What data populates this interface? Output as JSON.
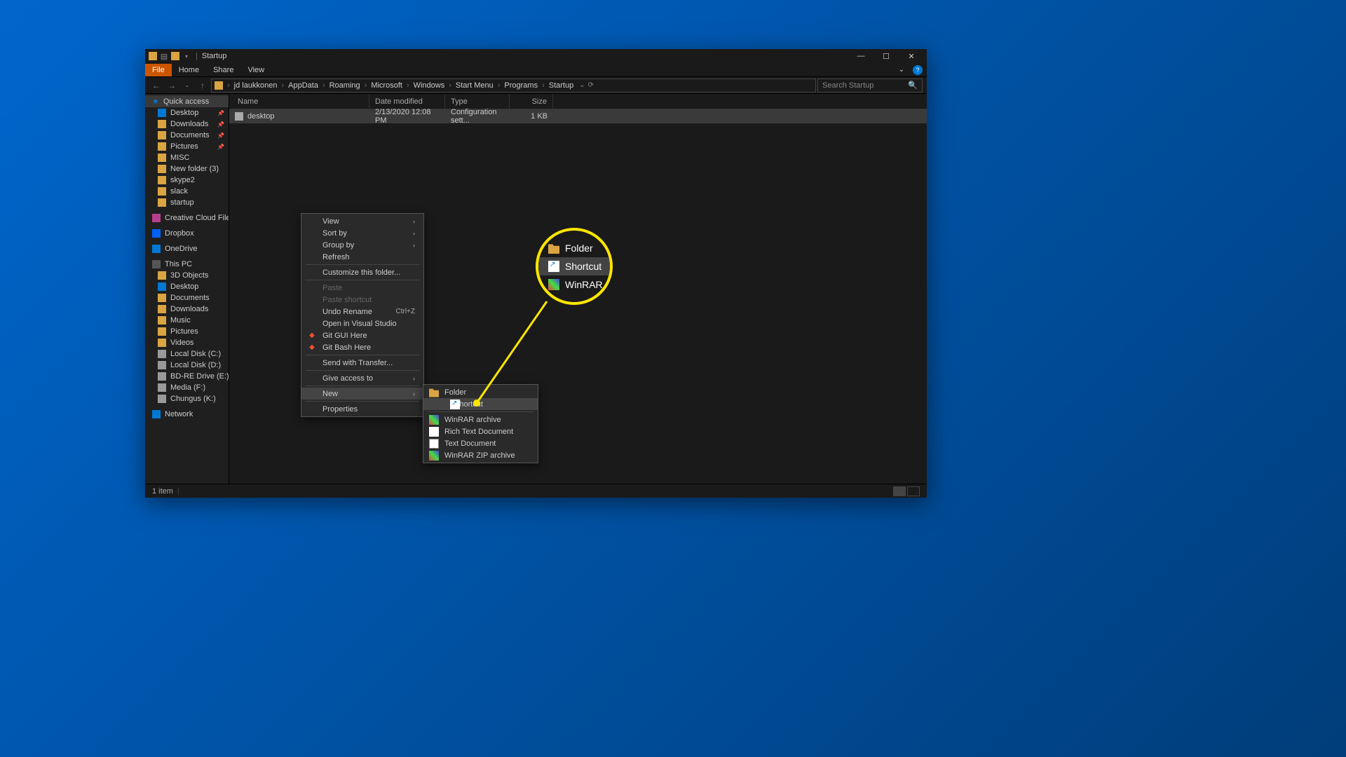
{
  "window": {
    "title": "Startup"
  },
  "titlebar_icons": [
    "folder-icon",
    "save-icon",
    "folder-open-icon"
  ],
  "ribbon": {
    "tabs": [
      "File",
      "Home",
      "Share",
      "View"
    ]
  },
  "breadcrumbs": [
    "jd laukkonen",
    "AppData",
    "Roaming",
    "Microsoft",
    "Windows",
    "Start Menu",
    "Programs",
    "Startup"
  ],
  "search": {
    "placeholder": "Search Startup"
  },
  "sidebar": {
    "quick_access": {
      "label": "Quick access"
    },
    "quick_items": [
      {
        "label": "Desktop",
        "icon": "icon-desktop",
        "pinned": true
      },
      {
        "label": "Downloads",
        "icon": "icon-folder",
        "pinned": true
      },
      {
        "label": "Documents",
        "icon": "icon-folder",
        "pinned": true
      },
      {
        "label": "Pictures",
        "icon": "icon-folder",
        "pinned": true
      },
      {
        "label": "MISC",
        "icon": "icon-folder",
        "pinned": false
      },
      {
        "label": "New folder (3)",
        "icon": "icon-folder",
        "pinned": false
      },
      {
        "label": "skype2",
        "icon": "icon-folder",
        "pinned": false
      },
      {
        "label": "slack",
        "icon": "icon-folder",
        "pinned": false
      },
      {
        "label": "startup",
        "icon": "icon-folder",
        "pinned": false
      }
    ],
    "creative_cloud": "Creative Cloud Files",
    "dropbox": "Dropbox",
    "onedrive": "OneDrive",
    "this_pc": {
      "label": "This PC"
    },
    "pc_items": [
      {
        "label": "3D Objects",
        "icon": "icon-folder"
      },
      {
        "label": "Desktop",
        "icon": "icon-desktop"
      },
      {
        "label": "Documents",
        "icon": "icon-folder"
      },
      {
        "label": "Downloads",
        "icon": "icon-folder"
      },
      {
        "label": "Music",
        "icon": "icon-folder"
      },
      {
        "label": "Pictures",
        "icon": "icon-folder"
      },
      {
        "label": "Videos",
        "icon": "icon-folder"
      },
      {
        "label": "Local Disk (C:)",
        "icon": "icon-drive"
      },
      {
        "label": "Local Disk (D:)",
        "icon": "icon-drive"
      },
      {
        "label": "BD-RE Drive (E:) GG",
        "icon": "icon-drive"
      },
      {
        "label": "Media (F:)",
        "icon": "icon-drive"
      },
      {
        "label": "Chungus (K:)",
        "icon": "icon-drive"
      }
    ],
    "network": "Network"
  },
  "columns": {
    "name": "Name",
    "date": "Date modified",
    "type": "Type",
    "size": "Size"
  },
  "files": [
    {
      "name": "desktop",
      "date": "2/13/2020 12:08 PM",
      "type": "Configuration sett...",
      "size": "1 KB"
    }
  ],
  "statusbar": {
    "count": "1 item"
  },
  "context_menu": {
    "items": [
      {
        "label": "View",
        "submenu": true
      },
      {
        "label": "Sort by",
        "submenu": true
      },
      {
        "label": "Group by",
        "submenu": true
      },
      {
        "label": "Refresh"
      },
      {
        "sep": true
      },
      {
        "label": "Customize this folder..."
      },
      {
        "sep": true
      },
      {
        "label": "Paste",
        "disabled": true
      },
      {
        "label": "Paste shortcut",
        "disabled": true
      },
      {
        "label": "Undo Rename",
        "shortcut": "Ctrl+Z"
      },
      {
        "label": "Open in Visual Studio"
      },
      {
        "label": "Git GUI Here",
        "icon": "git"
      },
      {
        "label": "Git Bash Here",
        "icon": "git"
      },
      {
        "sep": true
      },
      {
        "label": "Send with Transfer..."
      },
      {
        "sep": true
      },
      {
        "label": "Give access to",
        "submenu": true
      },
      {
        "sep": true
      },
      {
        "label": "New",
        "submenu": true,
        "highlighted": true
      },
      {
        "sep": true
      },
      {
        "label": "Properties"
      }
    ]
  },
  "new_submenu": {
    "items": [
      {
        "label": "Folder",
        "icon": "folder-ic"
      },
      {
        "label": "Shortcut",
        "icon": "shortcut-ic",
        "highlighted": true
      },
      {
        "sep": true
      },
      {
        "label": "WinRAR archive",
        "icon": "winrar-ic"
      },
      {
        "label": "Rich Text Document",
        "icon": "richtext-ic"
      },
      {
        "label": "Text Document",
        "icon": "text-ic"
      },
      {
        "label": "WinRAR ZIP archive",
        "icon": "winrar-ic"
      }
    ]
  },
  "highlight": {
    "items": [
      {
        "label": "Folder",
        "icon": "folder-ic"
      },
      {
        "label": "Shortcut",
        "icon": "shortcut-ic",
        "highlighted": true
      },
      {
        "label": "WinRAR",
        "icon": "winrar-ic"
      }
    ]
  }
}
